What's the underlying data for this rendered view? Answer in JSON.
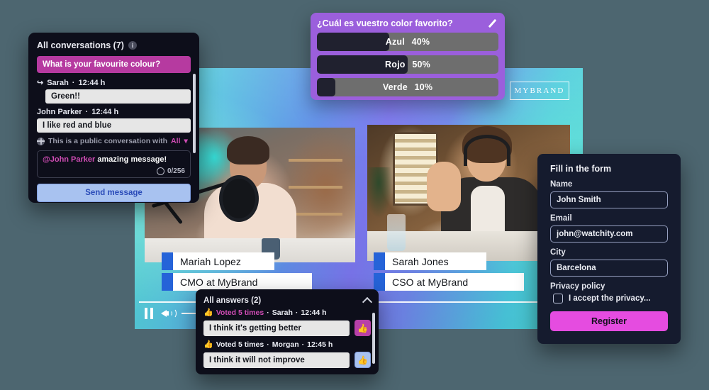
{
  "background_color": "#4d6670",
  "broadcast": {
    "brand_logo": "MYBRAND",
    "gradient_from": "#52e0d4",
    "gradient_mid": "#7b76ee",
    "gradient_to": "#4fdfd4"
  },
  "speakers": [
    {
      "name": "Mariah Lopez",
      "role": "CMO at MyBrand"
    },
    {
      "name": "Sarah Jones",
      "role": "CSO at MyBrand"
    }
  ],
  "player": {
    "pause_icon": "pause-icon",
    "volume_icon": "volume-icon"
  },
  "chat": {
    "title": "All conversations (7)",
    "info_icon": "info-icon",
    "question": "What is your favourite colour?",
    "messages": [
      {
        "reply_icon": "reply-icon",
        "author": "Sarah",
        "time": "12:44 h",
        "text": "Green!!",
        "indent": true
      },
      {
        "author": "John Parker",
        "time": "12:44 h",
        "text": "I like red and blue",
        "indent": false
      }
    ],
    "visibility_prefix": "This is a public conversation with",
    "visibility_value": "All",
    "globe_icon": "globe-icon",
    "chevron_icon": "chevron-down-icon",
    "composer": {
      "mention": "@John Parker",
      "text": "amazing message!",
      "emoji_icon": "emoji-icon",
      "counter": "0/256"
    },
    "send_label": "Send message",
    "accent_question": "#b63aa0",
    "accent_send": "#a8c2f0"
  },
  "poll": {
    "question": "¿Cuál es vuestro color favorito?",
    "edit_icon": "pencil-icon",
    "panel_color": "#9b5fdc",
    "options": [
      {
        "label": "Azul",
        "pct_label": "40%",
        "pct": 40
      },
      {
        "label": "Rojo",
        "pct_label": "50%",
        "pct": 50
      },
      {
        "label": "Verde",
        "pct_label": "10%",
        "pct": 10
      }
    ]
  },
  "answers": {
    "title": "All answers (2)",
    "collapse_icon": "chevron-up-icon",
    "items": [
      {
        "thumb_icon": "thumbs-up-icon",
        "votes": "Voted 5 times",
        "author": "Sarah",
        "time": "12:44 h",
        "text": "I think it's getting better",
        "button_icon": "thumbs-up-icon",
        "highlighted": true
      },
      {
        "thumb_icon": "thumbs-up-icon",
        "votes": "Voted 5 times",
        "author": "Morgan",
        "time": "12:45 h",
        "text": "I think it will not improve",
        "button_icon": "thumbs-up-icon",
        "highlighted": false
      }
    ]
  },
  "form": {
    "title": "Fill in the form",
    "fields": [
      {
        "label": "Name",
        "value": "John Smith",
        "placeholder": "Name"
      },
      {
        "label": "Email",
        "value": "john@watchity.com",
        "placeholder": "Email"
      },
      {
        "label": "City",
        "value": "Barcelona",
        "placeholder": "City"
      }
    ],
    "privacy_label": "Privacy policy",
    "privacy_text": "I accept the privacy...",
    "submit_label": "Register",
    "submit_color": "#e54ce0"
  }
}
